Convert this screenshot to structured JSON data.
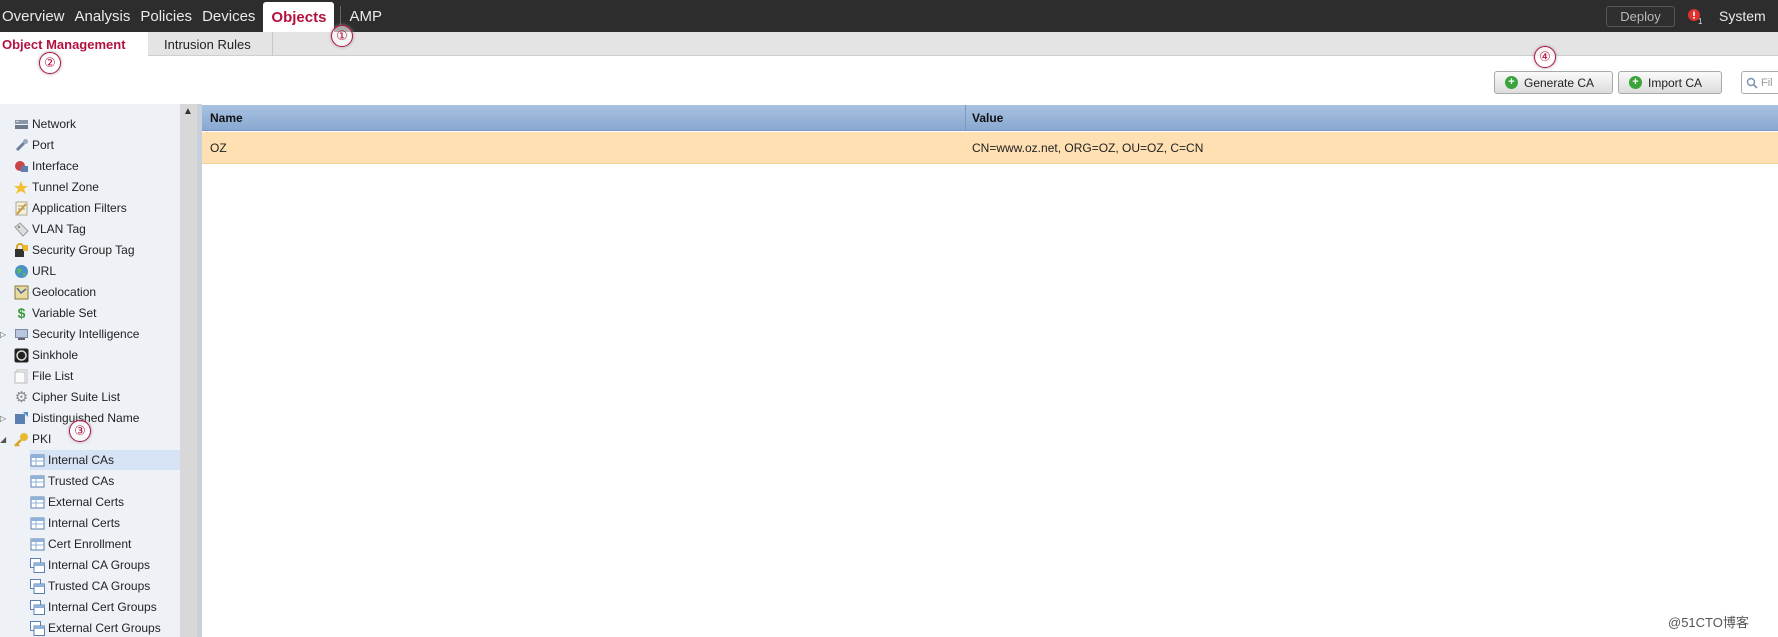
{
  "topnav": {
    "items": [
      "Overview",
      "Analysis",
      "Policies",
      "Devices",
      "Objects",
      "AMP"
    ],
    "deploy_label": "Deploy",
    "alert_count": "1",
    "system_label": "System"
  },
  "subtabs": {
    "object_management": "Object Management",
    "intrusion_rules": "Intrusion Rules"
  },
  "toolbar": {
    "generate_ca": "Generate CA",
    "import_ca": "Import CA",
    "filter_placeholder": "Fil"
  },
  "sidebar": {
    "items": [
      {
        "label": "Network",
        "icon": "network-icon"
      },
      {
        "label": "Port",
        "icon": "port-icon"
      },
      {
        "label": "Interface",
        "icon": "interface-icon"
      },
      {
        "label": "Tunnel Zone",
        "icon": "tunnel-zone-icon"
      },
      {
        "label": "Application Filters",
        "icon": "application-filters-icon"
      },
      {
        "label": "VLAN Tag",
        "icon": "vlan-tag-icon"
      },
      {
        "label": "Security Group Tag",
        "icon": "security-group-tag-icon"
      },
      {
        "label": "URL",
        "icon": "url-globe-icon"
      },
      {
        "label": "Geolocation",
        "icon": "geolocation-icon"
      },
      {
        "label": "Variable Set",
        "icon": "dollar-icon"
      },
      {
        "label": "Security Intelligence",
        "icon": "security-intelligence-icon"
      },
      {
        "label": "Sinkhole",
        "icon": "sinkhole-icon"
      },
      {
        "label": "File List",
        "icon": "file-list-icon"
      },
      {
        "label": "Cipher Suite List",
        "icon": "gear-icon"
      },
      {
        "label": "Distinguished Name",
        "icon": "distinguished-name-icon"
      },
      {
        "label": "PKI",
        "icon": "key-icon"
      },
      {
        "label": "Internal CAs",
        "icon": "table-icon"
      },
      {
        "label": "Trusted CAs",
        "icon": "table-icon"
      },
      {
        "label": "External Certs",
        "icon": "table-icon"
      },
      {
        "label": "Internal Certs",
        "icon": "table-icon"
      },
      {
        "label": "Cert Enrollment",
        "icon": "table-icon"
      },
      {
        "label": "Internal CA Groups",
        "icon": "group-table-icon"
      },
      {
        "label": "Trusted CA Groups",
        "icon": "group-table-icon"
      },
      {
        "label": "Internal Cert Groups",
        "icon": "group-table-icon"
      },
      {
        "label": "External Cert Groups",
        "icon": "group-table-icon"
      }
    ]
  },
  "table": {
    "columns": [
      "Name",
      "Value"
    ],
    "rows": [
      [
        "OZ",
        "CN=www.oz.net, ORG=OZ, OU=OZ, C=CN"
      ]
    ]
  },
  "markers": [
    "①",
    "②",
    "③",
    "④"
  ],
  "watermark": "@51CTO博客",
  "colors": {
    "accent": "#b3123e",
    "topbar": "#2d2d2d",
    "header": "#98b5db",
    "selected_row": "#ffe0b2"
  }
}
